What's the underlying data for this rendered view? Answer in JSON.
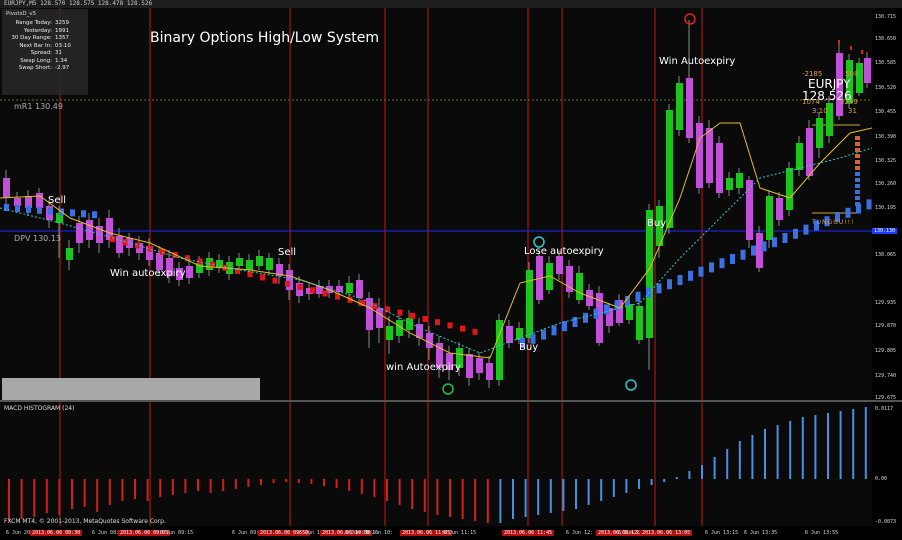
{
  "window": {
    "title": "EURJPY,M5  128.570 128.575 128.478 128.526"
  },
  "chart_title": "Binary Options High/Low System",
  "pivot_table": {
    "title": "PivotsD_v5",
    "rows": [
      {
        "key": "Range Today:",
        "value": "3259"
      },
      {
        "key": "Yesterday:",
        "value": "1991"
      },
      {
        "key": "30 Day Range:",
        "value": "1357"
      },
      {
        "key": "Next Bar In:",
        "value": "03:10"
      },
      {
        "key": "Spread:",
        "value": "31"
      },
      {
        "key": "Swap Long:",
        "value": "1.34"
      },
      {
        "key": "Swap Short:",
        "value": "-2.97"
      }
    ]
  },
  "labels": {
    "mr1": "mR1  130.49",
    "dpv": "DPV  130.13",
    "tunggu": "TUNGGU!!!"
  },
  "annotations": {
    "sell_1": "Sell",
    "sell_2": "Sell",
    "win_1": "Win autoexpiry",
    "win_2": "Win Autoexpiry",
    "win_3": "win Autoexpiry",
    "buy_1": "Buy",
    "buy_2": "Buy",
    "lose": "Lose autoexpiry"
  },
  "symbol_box": {
    "left_num": "-2185",
    "right_num": "508",
    "symbol": "EURJPY",
    "price": "128.526",
    "r1": "1074",
    "r2": "3259",
    "r3": "3:10",
    "r4": "31"
  },
  "price_axis": [
    "130.715",
    "130.650",
    "130.585",
    "130.520",
    "130.455",
    "130.390",
    "130.325",
    "130.260",
    "130.195",
    "130.130",
    "130.065",
    "129.935",
    "129.870",
    "129.805",
    "129.740",
    "129.675"
  ],
  "current_price": "130.130",
  "macd": {
    "title": "MACD HISTOGRAM (24)",
    "top": "0.0117",
    "zero": "0.00",
    "bottom": "-0.0073"
  },
  "copyright": "FXCM MT4, © 2001-2013, MetaQuotes Software Corp.",
  "time_axis": [
    "6 Jun 201",
    "2013.06.06 08:30",
    "6 Jun 08:",
    "2013.06.06 09:05",
    "6 Jun 09:15",
    "6 Jun 09:",
    "2013.06.06 09:50",
    "6 Jun 10:",
    "2013.06.06 10:30",
    "6 Jun 10:15",
    "6 Jun 10:",
    "2013.06.06 11:05",
    "6 Jun 11:15",
    "2013.06.06 11:45",
    "6 Jun 12:",
    "2013.06.06 12:30",
    "6 Jun 12:",
    "2013.06.06 13:05",
    "6 Jun 13:15",
    "6 Jun 13:35",
    "6 Jun 13:55"
  ],
  "colors": {
    "up": "#1ec41e",
    "down": "#c050d8",
    "red_marker": "#e01818",
    "blue_marker": "#3a70e0",
    "macd_neg": "#d02020",
    "macd_pos": "#4a90e0",
    "ma": "#e0c020"
  }
}
